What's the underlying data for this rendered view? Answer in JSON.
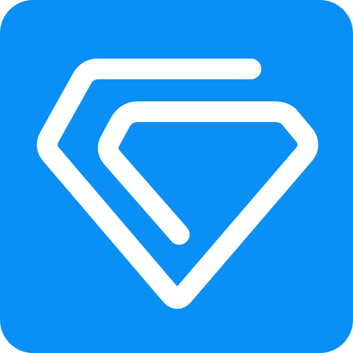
{
  "icon": {
    "name": "diamond-logo-app-icon",
    "background_color": "#0A8FF7",
    "stroke_color": "#FFFFFF"
  }
}
